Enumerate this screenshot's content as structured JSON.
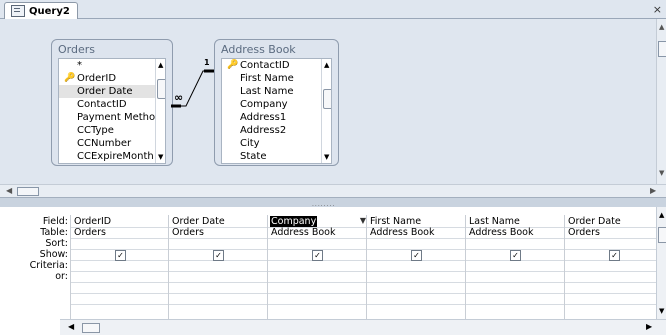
{
  "tab": {
    "label": "Query2",
    "icon": "query-icon",
    "close": "×"
  },
  "tables": [
    {
      "title": "Orders",
      "fields": [
        "*",
        "OrderID",
        "Order Date",
        "ContactID",
        "Payment Method",
        "CCType",
        "CCNumber",
        "CCExpireMonth"
      ],
      "key_field": "OrderID",
      "selected_field": "Order Date"
    },
    {
      "title": "Address Book",
      "fields": [
        "ContactID",
        "First Name",
        "Last Name",
        "Company",
        "Address1",
        "Address2",
        "City",
        "State"
      ],
      "key_field": "ContactID",
      "selected_field": ""
    }
  ],
  "relationship": {
    "one_label": "1",
    "many_label": "∞"
  },
  "grid": {
    "row_labels": [
      "Field:",
      "Table:",
      "Sort:",
      "Show:",
      "Criteria:",
      "or:"
    ],
    "columns": [
      {
        "field": "OrderID",
        "table": "Orders",
        "show": true
      },
      {
        "field": "Order Date",
        "table": "Orders",
        "show": true
      },
      {
        "field": "Company",
        "table": "Address Book",
        "show": true,
        "active": true
      },
      {
        "field": "First Name",
        "table": "Address Book",
        "show": true
      },
      {
        "field": "Last Name",
        "table": "Address Book",
        "show": true
      },
      {
        "field": "Order Date",
        "table": "Orders",
        "show": true
      }
    ],
    "check_mark": "✓",
    "dropdown_arrow": "▼"
  },
  "splitter_grip": "........"
}
